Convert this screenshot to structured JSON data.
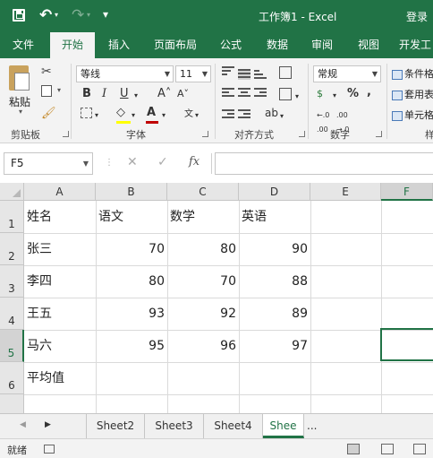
{
  "titlebar": {
    "title": "工作簿1  -  Excel",
    "login": "登录",
    "bg_color": "#217346",
    "icons": [
      "save-icon",
      "undo-icon",
      "redo-icon",
      "customize-icon"
    ]
  },
  "tabs": [
    {
      "label": "文件"
    },
    {
      "label": "开始",
      "active": true
    },
    {
      "label": "插入"
    },
    {
      "label": "页面布局"
    },
    {
      "label": "公式"
    },
    {
      "label": "数据"
    },
    {
      "label": "审阅"
    },
    {
      "label": "视图"
    },
    {
      "label": "开发工"
    }
  ],
  "ribbon": {
    "clipboard": {
      "paste_label": "粘贴",
      "group_label": "剪贴板",
      "icons": [
        "cut-icon",
        "copy-icon",
        "format-painter-icon"
      ]
    },
    "font": {
      "font_name": "等线",
      "font_size": "11",
      "group_label": "字体",
      "bold": "B",
      "italic": "I",
      "underline": "U",
      "grow": "A˄",
      "shrink": "A˅",
      "font_color": "A",
      "wen": "文",
      "fill_color_hex": "#ffff00",
      "font_color_hex": "#c00000"
    },
    "alignment": {
      "group_label": "对齐方式",
      "orientation": "ab"
    },
    "number": {
      "format": "常规",
      "group_label": "数字",
      "percent": "%",
      "comma": ",",
      "increase_decimal": ".00→.0",
      "currency": "$"
    },
    "styles": {
      "conditional": "条件格",
      "table": "套用表",
      "cell": "单元格",
      "group_label": "样"
    }
  },
  "formula_bar": {
    "name_box": "F5",
    "fx": "fx",
    "cancel": "✕",
    "enter": "✓",
    "formula": ""
  },
  "grid": {
    "columns": [
      "A",
      "B",
      "C",
      "D",
      "E",
      "F"
    ],
    "selected_column": "F",
    "selected_row": "5",
    "rows": [
      {
        "num": "1",
        "cells": [
          "姓名",
          "语文",
          "数学",
          "英语"
        ]
      },
      {
        "num": "2",
        "cells": [
          "张三",
          "70",
          "80",
          "90"
        ]
      },
      {
        "num": "3",
        "cells": [
          "李四",
          "80",
          "70",
          "88"
        ]
      },
      {
        "num": "4",
        "cells": [
          "王五",
          "93",
          "92",
          "89"
        ]
      },
      {
        "num": "5",
        "cells": [
          "马六",
          "95",
          "96",
          "97"
        ]
      },
      {
        "num": "6",
        "cells": [
          "平均值",
          "",
          "",
          ""
        ]
      },
      {
        "num": "7",
        "cells": [
          "",
          "",
          "",
          ""
        ]
      }
    ]
  },
  "sheets": {
    "tabs": [
      "Sheet2",
      "Sheet3",
      "Sheet4",
      "Shee"
    ],
    "active": "Shee",
    "more": "..."
  },
  "status": {
    "ready": "就绪"
  },
  "accent_color": "#217346"
}
